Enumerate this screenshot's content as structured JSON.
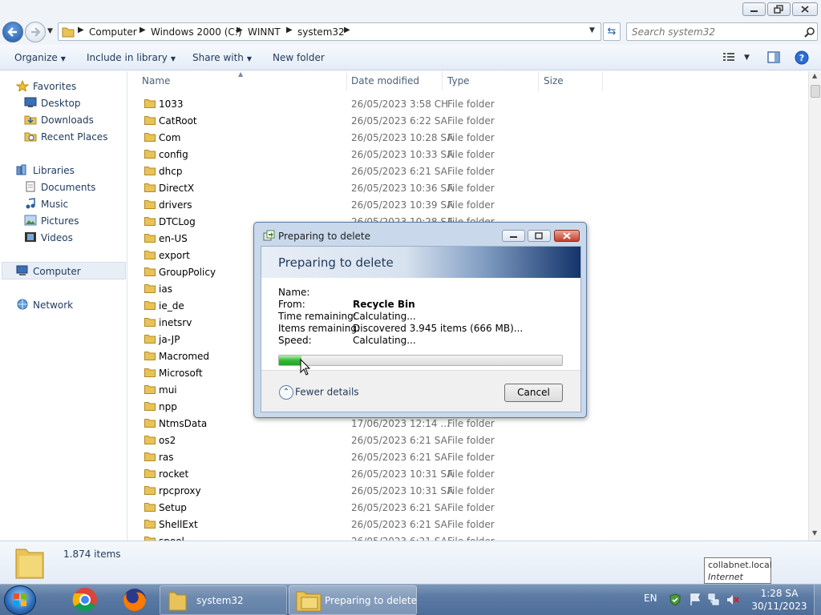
{
  "window": {
    "caption_buttons": [
      "minimize",
      "restore",
      "close"
    ]
  },
  "address_bar": {
    "crumbs": [
      "Computer",
      "Windows 2000 (C:)",
      "WINNT",
      "system32"
    ]
  },
  "search": {
    "placeholder": "Search system32"
  },
  "toolbar": {
    "organize": "Organize",
    "include_in_library": "Include in library",
    "share_with": "Share with",
    "new_folder": "New folder"
  },
  "nav": {
    "favorites": "Favorites",
    "desktop": "Desktop",
    "downloads": "Downloads",
    "recent_places": "Recent Places",
    "libraries": "Libraries",
    "documents": "Documents",
    "music": "Music",
    "pictures": "Pictures",
    "videos": "Videos",
    "computer": "Computer",
    "network": "Network"
  },
  "columns": {
    "name": "Name",
    "date_modified": "Date modified",
    "type": "Type",
    "size": "Size"
  },
  "files": [
    {
      "name": "1033",
      "date": "26/05/2023 3:58 CH",
      "type": "File folder"
    },
    {
      "name": "CatRoot",
      "date": "26/05/2023 6:22 SA",
      "type": "File folder"
    },
    {
      "name": "Com",
      "date": "26/05/2023 10:28 SA",
      "type": "File folder"
    },
    {
      "name": "config",
      "date": "26/05/2023 10:33 SA",
      "type": "File folder"
    },
    {
      "name": "dhcp",
      "date": "26/05/2023 6:21 SA",
      "type": "File folder"
    },
    {
      "name": "DirectX",
      "date": "26/05/2023 10:36 SA",
      "type": "File folder"
    },
    {
      "name": "drivers",
      "date": "26/05/2023 10:39 SA",
      "type": "File folder"
    },
    {
      "name": "DTCLog",
      "date": "26/05/2023 10:28 SA",
      "type": "File folder"
    },
    {
      "name": "en-US",
      "date": "",
      "type": ""
    },
    {
      "name": "export",
      "date": "",
      "type": ""
    },
    {
      "name": "GroupPolicy",
      "date": "",
      "type": ""
    },
    {
      "name": "ias",
      "date": "",
      "type": ""
    },
    {
      "name": "ie_de",
      "date": "",
      "type": ""
    },
    {
      "name": "inetsrv",
      "date": "",
      "type": ""
    },
    {
      "name": "ja-JP",
      "date": "",
      "type": ""
    },
    {
      "name": "Macromed",
      "date": "",
      "type": ""
    },
    {
      "name": "Microsoft",
      "date": "",
      "type": ""
    },
    {
      "name": "mui",
      "date": "",
      "type": ""
    },
    {
      "name": "npp",
      "date": "",
      "type": ""
    },
    {
      "name": "NtmsData",
      "date": "17/06/2023 12:14 ...",
      "type": "File folder"
    },
    {
      "name": "os2",
      "date": "26/05/2023 6:21 SA",
      "type": "File folder"
    },
    {
      "name": "ras",
      "date": "26/05/2023 6:21 SA",
      "type": "File folder"
    },
    {
      "name": "rocket",
      "date": "26/05/2023 10:31 SA",
      "type": "File folder"
    },
    {
      "name": "rpcproxy",
      "date": "26/05/2023 10:31 SA",
      "type": "File folder"
    },
    {
      "name": "Setup",
      "date": "26/05/2023 6:21 SA",
      "type": "File folder"
    },
    {
      "name": "ShellExt",
      "date": "26/05/2023 6:21 SA",
      "type": "File folder"
    },
    {
      "name": "spool",
      "date": "26/05/2023 6:21 SA",
      "type": "File folder"
    }
  ],
  "status": {
    "items": "1.874 items"
  },
  "tooltip": {
    "line1": "collabnet.local",
    "line2": "Internet access"
  },
  "dialog": {
    "title": "Preparing to delete",
    "heading": "Preparing to delete",
    "labels": {
      "name": "Name:",
      "from": "From:",
      "time_remaining": "Time remaining:",
      "items_remaining": "Items remaining:",
      "speed": "Speed:"
    },
    "values": {
      "name": "",
      "from": "Recycle Bin",
      "time_remaining": "Calculating...",
      "items_remaining": "Discovered 3.945 items (666 MB)...",
      "speed": "Calculating..."
    },
    "progress_percent": 8,
    "fewer_details": "Fewer details",
    "cancel": "Cancel"
  },
  "taskbar": {
    "buttons": [
      {
        "label": "system32"
      },
      {
        "label": "Preparing to delete"
      }
    ],
    "language": "EN",
    "clock_time": "1:28 SA",
    "clock_date": "30/11/2023"
  },
  "colors": {
    "accent": "#1e395b",
    "progress_green": "#38b838",
    "taskbar": "#5a7aa4"
  }
}
